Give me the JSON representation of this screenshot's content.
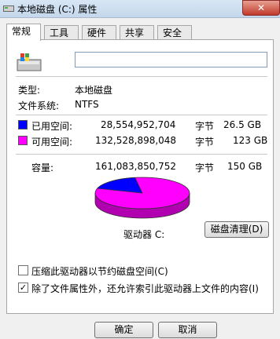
{
  "window": {
    "title": "本地磁盘 (C:) 属性"
  },
  "tabs": [
    {
      "label": "常规",
      "active": true
    },
    {
      "label": "工具",
      "active": false
    },
    {
      "label": "硬件",
      "active": false
    },
    {
      "label": "共享",
      "active": false
    },
    {
      "label": "安全",
      "active": false
    }
  ],
  "general": {
    "volume_label_value": "",
    "type_label": "类型:",
    "type_value": "本地磁盘",
    "fs_label": "文件系统:",
    "fs_value": "NTFS",
    "used": {
      "label": "已用空间:",
      "bytes": "28,554,952,704",
      "unit": "字节",
      "size": "26.5 GB",
      "color": "#0000ff"
    },
    "free": {
      "label": "可用空间:",
      "bytes": "132,528,898,048",
      "unit": "字节",
      "size": "123 GB",
      "color": "#ff00ff"
    },
    "capacity": {
      "label": "容量:",
      "bytes": "161,083,850,752",
      "unit": "字节",
      "size": "150 GB"
    },
    "drive_label": "驱动器 C:",
    "cleanup_button": "磁盘清理(D)",
    "compress_checkbox": {
      "label": "压缩此驱动器以节约磁盘空间(C)",
      "checked": false
    },
    "index_checkbox": {
      "label": "除了文件属性外，还允许索引此驱动器上文件的内容(I)",
      "checked": true
    },
    "used_fraction": 0.177
  },
  "footer": {
    "ok": "确定",
    "cancel": "取消"
  }
}
